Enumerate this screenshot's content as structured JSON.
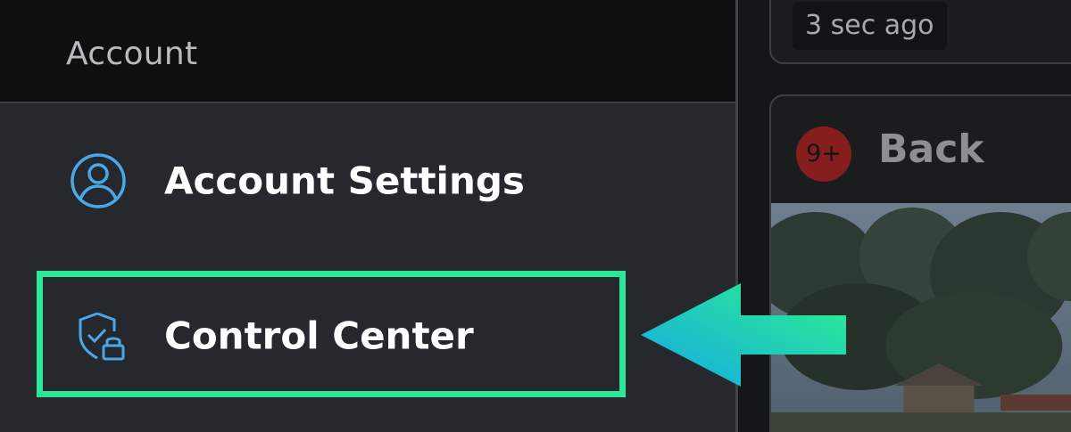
{
  "menu": {
    "section_title": "Account",
    "items": [
      {
        "label": "Account Settings",
        "icon": "user-circle-icon"
      },
      {
        "label": "Control Center",
        "icon": "shield-check-lock-icon"
      }
    ]
  },
  "feed": {
    "top_card": {
      "timestamp": "3 sec ago"
    },
    "back_card": {
      "badge": "9+",
      "name": "Back"
    }
  },
  "annotation": {
    "highlighted_item": "Control Center"
  },
  "colors": {
    "icon_blue": "#4aa8e8",
    "highlight_green": "#2de69a",
    "badge_red": "#8b1f1d",
    "arrow_cyan": "#18c4d8"
  }
}
